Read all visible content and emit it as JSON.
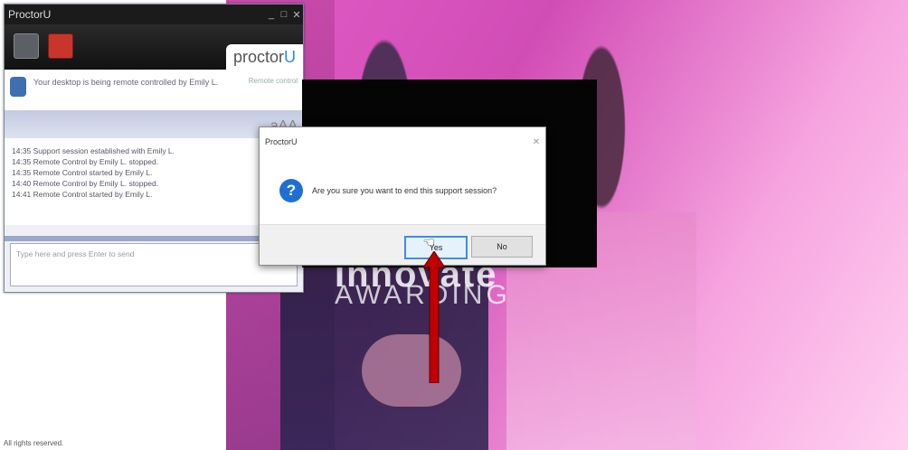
{
  "window": {
    "title": "ProctorU",
    "brand": "proctor",
    "brand_accent": "U"
  },
  "notice": {
    "text": "Your desktop is being remote controlled by Emily L.",
    "tag": "Remote control"
  },
  "font_size_icon": "aAA",
  "chat_log": [
    "14:35 Support session established with Emily L.",
    "14:35 Remote Control by Emily L. stopped.",
    "14:35 Remote Control started by Emily L.",
    "14:40 Remote Control by Emily L. stopped.",
    "14:41 Remote Control started by Emily L."
  ],
  "chat_input": {
    "placeholder": "Type here and press Enter to send"
  },
  "dialog": {
    "title": "ProctorU",
    "close": "✕",
    "icon": "question-icon",
    "message": "Are you sure you want to end this support session?",
    "yes_label": "Yes",
    "no_label": "No"
  },
  "background": {
    "brand_text": "Innovate",
    "tagline": "AWARDING"
  },
  "copyright": "All rights reserved.",
  "colors": {
    "accent": "#1f6fd1",
    "arrow": "#c00000",
    "pink_bg": "#e25bc6"
  }
}
